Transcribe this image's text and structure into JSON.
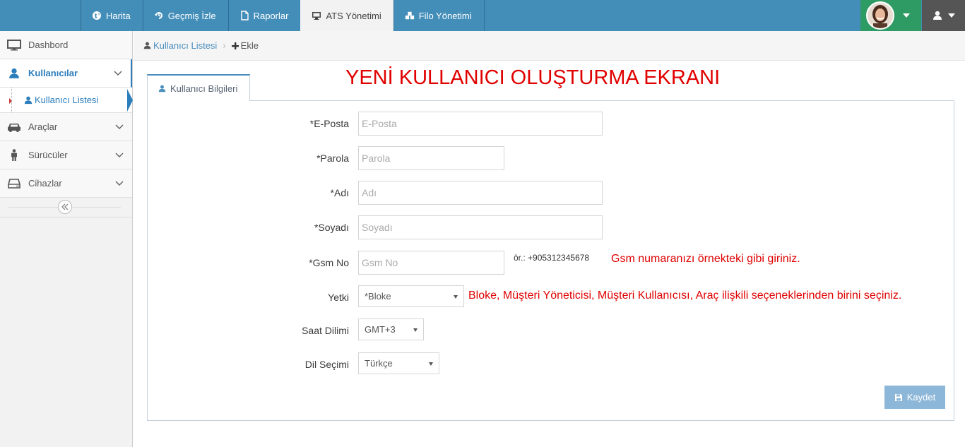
{
  "nav": {
    "items": [
      {
        "label": "Harita",
        "icon": "globe-icon"
      },
      {
        "label": "Geçmiş İzle",
        "icon": "history-icon"
      },
      {
        "label": "Raporlar",
        "icon": "document-icon"
      },
      {
        "label": "ATS Yönetimi",
        "icon": "monitor-icon",
        "active": true
      },
      {
        "label": "Filo Yönetimi",
        "icon": "cubes-icon"
      }
    ]
  },
  "sidebar": {
    "items": [
      {
        "label": "Dashbord",
        "icon": "desktop-icon"
      },
      {
        "label": "Kullanıcılar",
        "icon": "user-icon"
      },
      {
        "label": "Araçlar",
        "icon": "car-icon"
      },
      {
        "label": "Sürücüler",
        "icon": "male-icon"
      },
      {
        "label": "Cihazlar",
        "icon": "hdd-icon"
      }
    ],
    "sub_item": "Kullanıcı Listesi"
  },
  "breadcrumb": {
    "link": "Kullanıcı Listesi",
    "current": "Ekle"
  },
  "heading": "YENİ KULLANICI OLUŞTURMA EKRANI",
  "tab_label": "Kullanıcı Bilgileri",
  "form": {
    "email": {
      "label": "*E-Posta",
      "placeholder": "E-Posta"
    },
    "password": {
      "label": "*Parola",
      "placeholder": "Parola"
    },
    "name": {
      "label": "*Adı",
      "placeholder": "Adı"
    },
    "surname": {
      "label": "*Soyadı",
      "placeholder": "Soyadı"
    },
    "gsm": {
      "label": "*Gsm No",
      "placeholder": "Gsm No",
      "example": "ör.: +905312345678"
    },
    "role": {
      "label": "Yetki",
      "value": "*Bloke"
    },
    "timezone": {
      "label": "Saat Dilimi",
      "value": "GMT+3"
    },
    "language": {
      "label": "Dil Seçimi",
      "value": "Türkçe"
    }
  },
  "notes": {
    "gsm": "Gsm numaranızı örnekteki gibi giriniz.",
    "role": "Bloke, Müşteri Yöneticisi, Müşteri Kullanıcısı, Araç ilişkili seçeneklerinden birini seçiniz."
  },
  "save_label": "Kaydet",
  "colors": {
    "navbar": "#438eb9",
    "accent": "#2b7dbc",
    "note": "#e00000",
    "save": "#8db7d8"
  }
}
